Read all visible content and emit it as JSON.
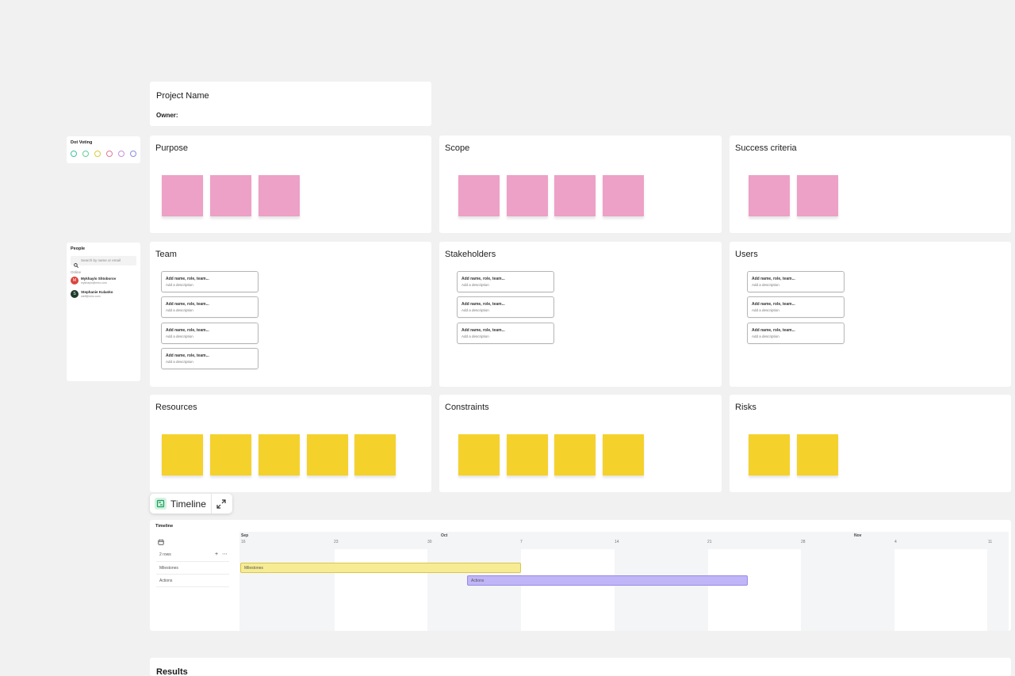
{
  "project": {
    "title": "Project Name",
    "owner_label": "Owner:"
  },
  "dot_voting": {
    "title": "Dot Voting",
    "dot_colors": [
      "#3cc4a4",
      "#5fcf9a",
      "#d4cf3c",
      "#e07a96",
      "#c98fdc",
      "#8b8ae8"
    ]
  },
  "people": {
    "title": "People",
    "search_placeholder": "Search by name or email",
    "online_label": "Online",
    "users": [
      {
        "name": "Mykhaylo Shtoborov",
        "email": "mykhaylo@miro.com",
        "color": "#d9453c",
        "initial": "M"
      },
      {
        "name": "Stephanie Kulanko",
        "email": "steff@miro.com",
        "color": "#1f3a2a",
        "initial": "S"
      }
    ]
  },
  "sections": {
    "purpose": "Purpose",
    "scope": "Scope",
    "success": "Success criteria",
    "team": "Team",
    "stakeholders": "Stakeholders",
    "users": "Users",
    "resources": "Resources",
    "constraints": "Constraints",
    "risks": "Risks",
    "results": "Results"
  },
  "card": {
    "title": "Add name, role, team...",
    "desc": "Add a description"
  },
  "timeline_toolbar": {
    "label": "Timeline"
  },
  "timeline": {
    "title": "Timeline",
    "months": [
      "Sep",
      "Oct",
      "Nov"
    ],
    "ticks": [
      "16",
      "23",
      "30",
      "7",
      "14",
      "21",
      "28",
      "4",
      "11"
    ],
    "actions_label": "2 rows",
    "rows": [
      "Milestones",
      "Actions"
    ],
    "bars": [
      {
        "label": "Milestones",
        "color": "#f7ec94"
      },
      {
        "label": "Actions",
        "color": "#c0b5f7"
      }
    ]
  },
  "colors": {
    "pink_sticky": "#eda1c6",
    "yellow_sticky": "#f5d12c",
    "canvas": "#f1f1f1",
    "accent": "#1b9c5a"
  }
}
